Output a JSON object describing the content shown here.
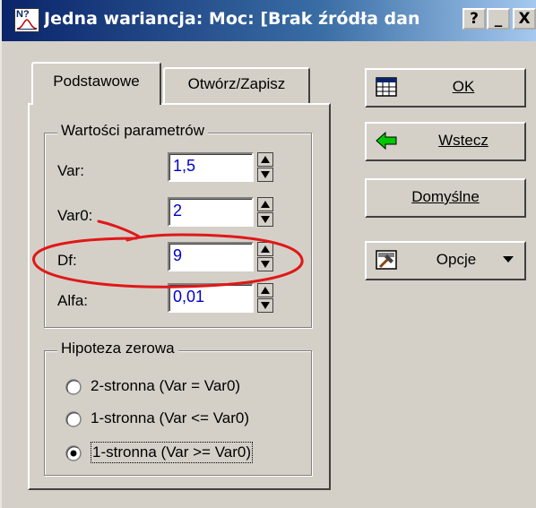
{
  "window": {
    "title": "Jedna wariancja: Moc: [Brak źródła dan",
    "app_icon_text": "N?",
    "buttons": {
      "help": "?",
      "minimize": "_",
      "close": "X"
    }
  },
  "tabs": [
    {
      "label": "Podstawowe",
      "active": true
    },
    {
      "label": "Otwórz/Zapisz",
      "active": false
    }
  ],
  "params": {
    "group_label": "Wartości parametrów",
    "fields": [
      {
        "label": "Var:",
        "value": "1,5"
      },
      {
        "label": "Var0:",
        "value": "2"
      },
      {
        "label": "Df:",
        "value": "9"
      },
      {
        "label": "Alfa:",
        "value": "0,01"
      }
    ]
  },
  "hypothesis": {
    "group_label": "Hipoteza zerowa",
    "options": [
      {
        "label": "2-stronna (Var = Var0)",
        "selected": false
      },
      {
        "label": "1-stronna (Var <= Var0)",
        "selected": false
      },
      {
        "label": "1-stronna (Var >= Var0)",
        "selected": true
      }
    ]
  },
  "buttons": {
    "ok": "OK",
    "back": "Wstecz",
    "defaults": "Domyślne",
    "options": "Opcje"
  },
  "annotation_color": "#e01818"
}
